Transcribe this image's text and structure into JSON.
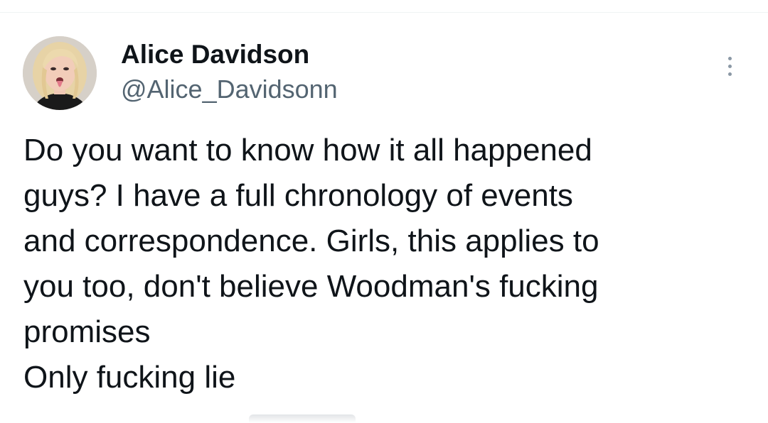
{
  "tweet": {
    "author": {
      "display_name": "Alice Davidson",
      "handle": "@Alice_Davidsonn",
      "avatar_icon": "profile-photo"
    },
    "more_icon": "more-vertical-icon",
    "text_lines": [
      "Do you want to know how it all happened",
      "guys? I have a full chronology of events",
      "and correspondence. Girls, this applies to",
      "you too, don't believe Woodman's fucking",
      "promises",
      "Only fucking lie"
    ]
  },
  "colors": {
    "text_primary": "#0f1419",
    "text_secondary": "#536471",
    "divider": "#eff3f4",
    "background": "#ffffff"
  }
}
